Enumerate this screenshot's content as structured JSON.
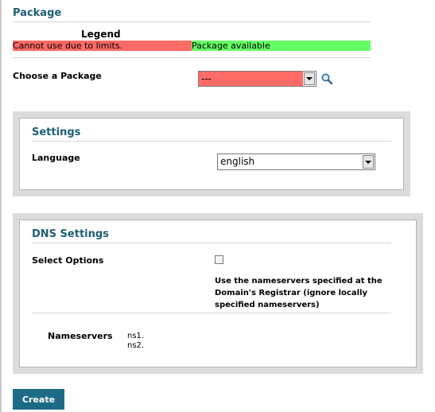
{
  "package": {
    "title": "Package",
    "legend_title": "Legend",
    "legend_unavailable": "Cannot use due to limits.",
    "legend_available": "Package available",
    "choose_label": "Choose a Package",
    "selected": "---",
    "unavailable_color": "#ff6b66",
    "available_color": "#66ff66"
  },
  "settings": {
    "title": "Settings",
    "language_label": "Language",
    "language_value": "english"
  },
  "dns": {
    "title": "DNS Settings",
    "select_options_label": "Select Options",
    "checkbox_checked": false,
    "checkbox_description": "Use the nameservers specified at the Domain's Registrar (ignore locally specified nameservers)",
    "nameservers_label": "Nameservers",
    "nameservers": [
      "ns1.",
      "ns2."
    ]
  },
  "actions": {
    "create_label": "Create"
  },
  "icons": {
    "search": "search-icon",
    "dropdown": "chevron-down-icon"
  },
  "colors": {
    "heading": "#1d5f74",
    "button": "#1d6b86"
  }
}
